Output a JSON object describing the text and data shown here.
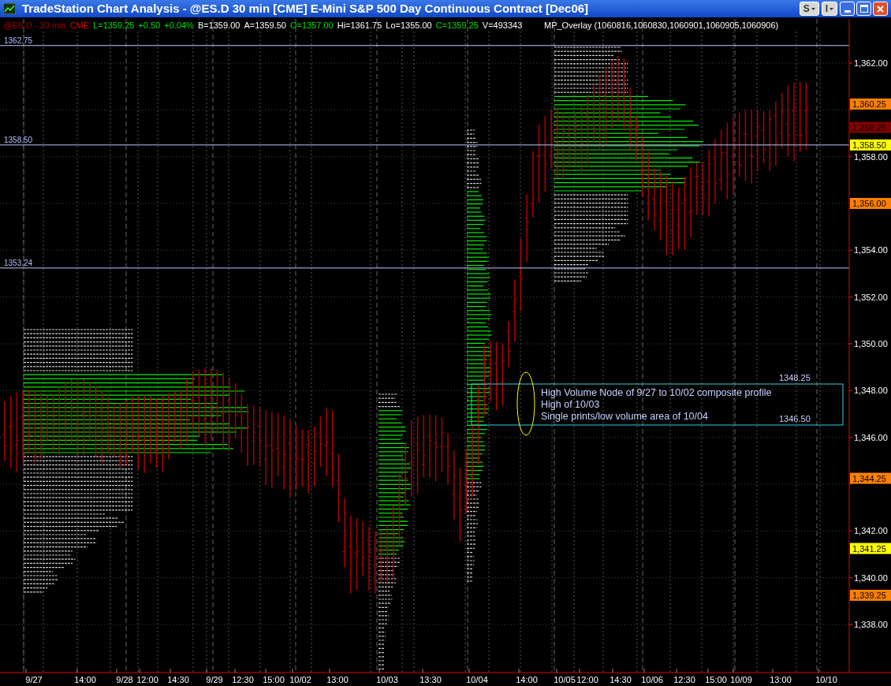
{
  "window": {
    "title": "TradeStation Chart Analysis - @ES.D  30 min  [CME] E-Mini S&P 500 Day Continuous Contract [Dec06]"
  },
  "title_buttons": [
    {
      "label": "S"
    },
    {
      "label": "I"
    }
  ],
  "chart": {
    "quote_header": [
      {
        "text": "@ES.D - 30 min",
        "color": "#a00000"
      },
      {
        "text": "CME",
        "color": "#e00000"
      },
      {
        "text": "L=1359.25",
        "color": "#00e000"
      },
      {
        "text": "+0.50",
        "color": "#00e000"
      },
      {
        "text": "+0.04%",
        "color": "#00e000"
      },
      {
        "text": "B=1359.00",
        "color": "#ffffff"
      },
      {
        "text": "A=1359.50",
        "color": "#ffffff"
      },
      {
        "text": "O=1357.00",
        "color": "#00e000"
      },
      {
        "text": "Hi=1361.75",
        "color": "#ffffff"
      },
      {
        "text": "Lo=1355.00",
        "color": "#ffffff"
      },
      {
        "text": "C=1359.25",
        "color": "#00e000"
      },
      {
        "text": "V=493343",
        "color": "#ffffff"
      }
    ],
    "overlay_label": "MP_Overlay  (1060816,1060830,1060901,1060905,1060906)",
    "level_lines": [
      {
        "label": "1362.75"
      },
      {
        "label": "1358.50"
      },
      {
        "label": "1353.24"
      }
    ],
    "y_axis_labels": [
      "1,362.00",
      "1,358.00",
      "1,354.00",
      "1,352.00",
      "1,350.00",
      "1,348.00",
      "1,346.00",
      "1,342.00",
      "1,340.00",
      "1,338.00"
    ],
    "price_tags": [
      {
        "text": "1,360.25",
        "color": "#ff8000"
      },
      {
        "text": "1,359.25",
        "color": "#800000"
      },
      {
        "text": "1,358.50",
        "color": "#ffff00"
      },
      {
        "text": "1,356.00",
        "color": "#ff8000"
      },
      {
        "text": "1,344.25",
        "color": "#ff8000"
      },
      {
        "text": "1,341.25",
        "color": "#ffff00"
      },
      {
        "text": "1,339.25",
        "color": "#ff8000"
      }
    ],
    "x_axis_labels": [
      "9/27",
      "14:00",
      "9/28",
      "12:00",
      "14:30",
      "9/29",
      "12:30",
      "15:00",
      "10/02",
      "13:00",
      "10/03",
      "13:30",
      "10/04",
      "14:00",
      "10/05",
      "12:00",
      "14:30",
      "10/06",
      "12:30",
      "15:00",
      "10/09",
      "13:00",
      "10/10"
    ],
    "annotation": {
      "top_value": "1348.25",
      "lines": [
        "High Volume Node of 9/27 to 10/02 composite profile",
        "High of 10/03",
        "Single prints/low volume area of 10/04"
      ],
      "bottom_value": "1346.50"
    }
  }
}
